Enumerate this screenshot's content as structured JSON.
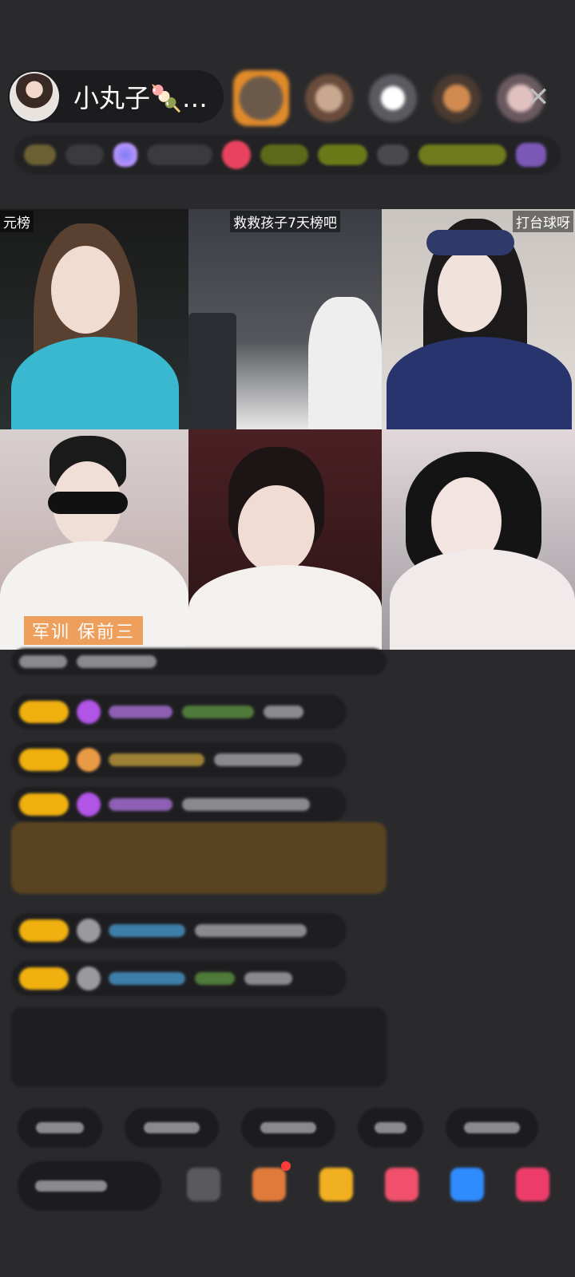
{
  "host": {
    "name": "小丸子🍡…"
  },
  "video_tiles": [
    {
      "label": "元榜",
      "bottom_label": ""
    },
    {
      "label": "救救孩子7天榜吧",
      "bottom_label": ""
    },
    {
      "label": "打台球呀",
      "bottom_label": ""
    },
    {
      "label": "",
      "bottom_label": "军训 保前三"
    },
    {
      "label": "",
      "bottom_label": ""
    },
    {
      "label": "",
      "bottom_label": ""
    }
  ],
  "colors": {
    "background": "#2a2a2d",
    "badge": "#f0b010",
    "accent_orange": "#ee964b"
  },
  "icons": {
    "close": "close-icon"
  }
}
